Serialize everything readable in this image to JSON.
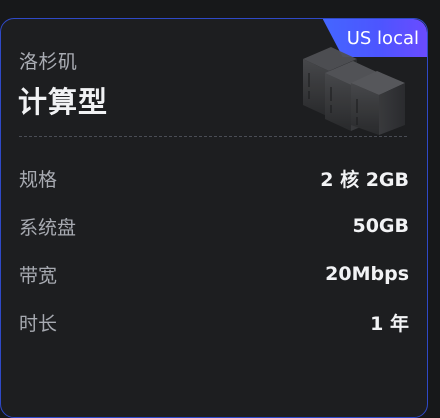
{
  "badge": {
    "label": "US local"
  },
  "card": {
    "region": "洛杉矶",
    "plan_name": "计算型"
  },
  "specs": [
    {
      "key": "规格",
      "value": "2 核 2GB"
    },
    {
      "key": "系统盘",
      "value": "50GB"
    },
    {
      "key": "带宽",
      "value": "20Mbps"
    },
    {
      "key": "时长",
      "value": "1 年"
    }
  ],
  "colors": {
    "accent": "#3b55ff",
    "border": "#2f49c7",
    "card_bg": "#1d1e20",
    "page_bg": "#17181a"
  },
  "icons": {
    "server": "server-rack-icon"
  }
}
